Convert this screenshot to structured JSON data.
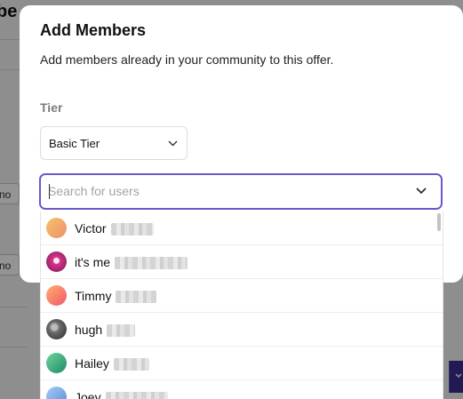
{
  "background": {
    "heading_fragment": "be",
    "cell_1": "no",
    "cell_2": "no"
  },
  "modal": {
    "title": "Add Members",
    "subtitle": "Add members already in your community to this offer.",
    "tier": {
      "label": "Tier",
      "selected": "Basic Tier"
    },
    "search": {
      "placeholder": "Search for users",
      "value": ""
    }
  },
  "users": [
    {
      "name": "Victor",
      "avatar_colors": [
        "#f6c36b",
        "#ee8f6a"
      ]
    },
    {
      "name": "it's me",
      "avatar_colors": [
        "#d4338b",
        "#7b1a56"
      ]
    },
    {
      "name": "Timmy",
      "avatar_colors": [
        "#ffb06b",
        "#f2566e"
      ]
    },
    {
      "name": "hugh",
      "avatar_colors": [
        "#8a8a8a",
        "#2b2b2b"
      ]
    },
    {
      "name": "Hailey",
      "avatar_colors": [
        "#6fd49a",
        "#1f8a6a"
      ]
    },
    {
      "name": "Joey",
      "avatar_colors": [
        "#a7c9f5",
        "#5a8ee0"
      ]
    }
  ],
  "colors": {
    "accent": "#6a5ac9",
    "primary_button": "#3b2f8f"
  }
}
